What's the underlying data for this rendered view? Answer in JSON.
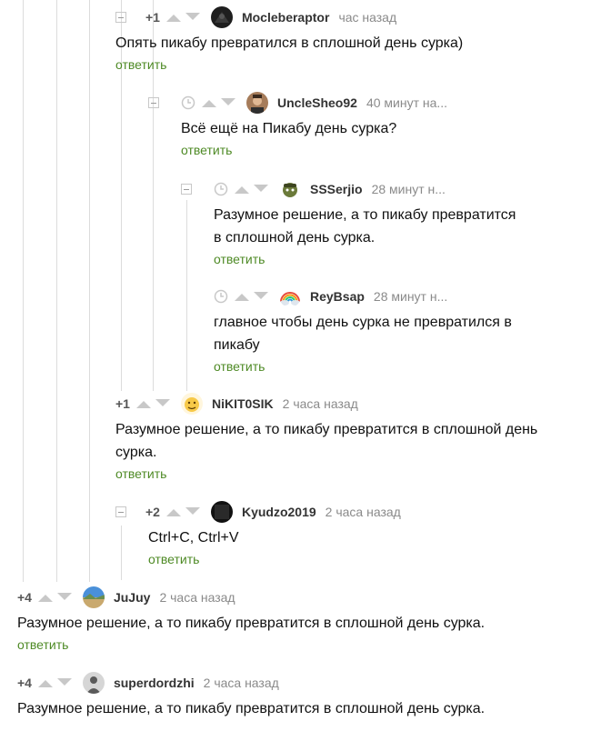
{
  "comments": [
    {
      "rating": "+1",
      "author": "Mocleberaptor",
      "time": "час назад",
      "text": "Опять пикабу превратился в сплошной день сурка)",
      "reply": "ответить"
    },
    {
      "rating": "",
      "author": "UncleSheo92",
      "time": "40 минут на...",
      "text": "Всё ещё на Пикабу день сурка?",
      "reply": "ответить"
    },
    {
      "rating": "",
      "author": "SSSerjio",
      "time": "28 минут н...",
      "text": "Разумное решение, а то пикабу превратится в сплошной день сурка.",
      "reply": "ответить"
    },
    {
      "rating": "",
      "author": "ReyBsap",
      "time": "28 минут н...",
      "text": "главное чтобы день сурка не превратился в пикабу",
      "reply": "ответить"
    },
    {
      "rating": "+1",
      "author": "NiKIT0SIK",
      "time": "2 часа назад",
      "text": "Разумное решение, а то пикабу превратится в сплошной день сурка.",
      "reply": "ответить"
    },
    {
      "rating": "+2",
      "author": "Kyudzo2019",
      "time": "2 часа назад",
      "text": "Ctrl+C, Ctrl+V",
      "reply": "ответить"
    },
    {
      "rating": "+4",
      "author": "JuJuy",
      "time": "2 часа назад",
      "text": "Разумное решение, а то пикабу превратится в сплошной день сурка.",
      "reply": "ответить"
    },
    {
      "rating": "+4",
      "author": "superdordzhi",
      "time": "2 часа назад",
      "text": "Разумное решение, а то пикабу превратится в сплошной день сурка.",
      "reply": ""
    }
  ],
  "colors": {
    "reply": "#4e8a25",
    "meta": "#8a8a8a",
    "branch": "#dcdcdc"
  },
  "icons": [
    "collapse-icon",
    "clock-icon",
    "upvote-icon",
    "downvote-icon"
  ]
}
